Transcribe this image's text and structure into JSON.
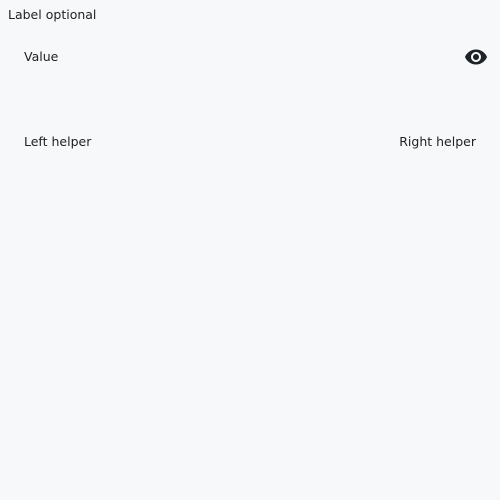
{
  "field": {
    "label": "Label",
    "optional_text": "optional",
    "value": "Value",
    "visibility_icon": "eye-icon",
    "helper_left": "Left helper",
    "helper_right": "Right helper"
  },
  "colors": {
    "background": "#f7f8fa",
    "text": "#222222",
    "icon": "#1f2328"
  }
}
